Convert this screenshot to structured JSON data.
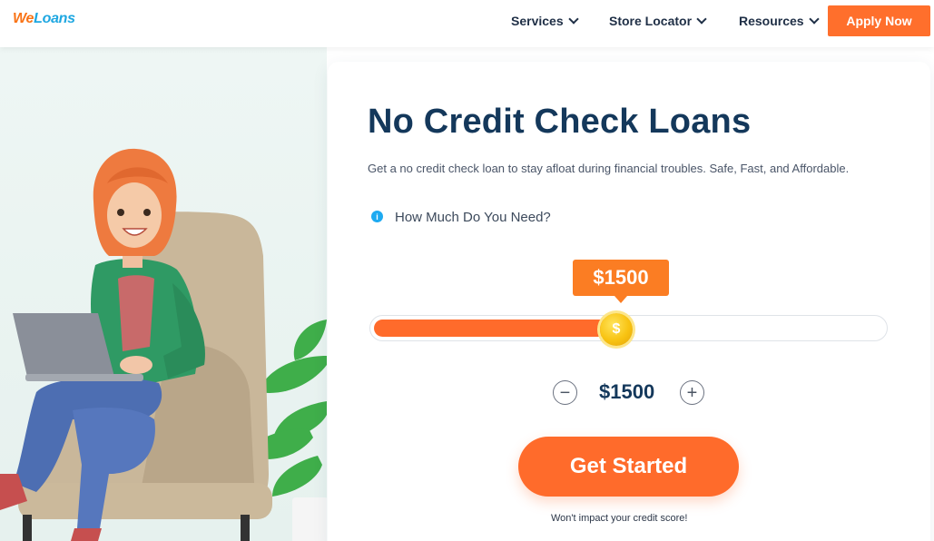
{
  "header": {
    "logo_we": "We",
    "logo_loans": "Loans",
    "nav": [
      {
        "label": "Services",
        "icon": "chevron-down-icon"
      },
      {
        "label": "Store Locator",
        "icon": "chevron-down-icon"
      },
      {
        "label": "Resources",
        "icon": "chevron-down-icon"
      }
    ],
    "apply_label": "Apply Now"
  },
  "hero": {
    "title": "No Credit Check Loans",
    "subtitle": "Get a no credit check loan to stay afloat during financial troubles. Safe, Fast, and Affordable.",
    "question": "How Much Do You Need?",
    "slider": {
      "tooltip_value": "$1500",
      "fill_fraction": 0.48,
      "thumb_icon": "dollar-coin-icon"
    },
    "stepper": {
      "minus_icon": "minus-circle-icon",
      "plus_icon": "plus-circle-icon",
      "value": "$1500"
    },
    "cta_label": "Get Started",
    "note": "Won't impact your credit score!"
  },
  "colors": {
    "accent": "#ff6b2b",
    "title": "#14385b",
    "info": "#1eaaf1",
    "coin": "#f8c312"
  }
}
